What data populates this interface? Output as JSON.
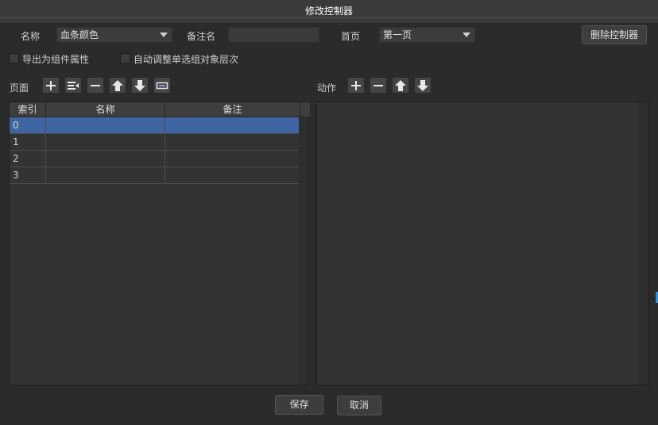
{
  "window": {
    "title": "修改控制器"
  },
  "form": {
    "name_label": "名称",
    "name_value": "血条颜色",
    "remark_label": "备注名",
    "remark_value": "",
    "home_label": "首页",
    "home_value": "第一页",
    "delete_button": "删除控制器",
    "export_checkbox": "导出为组件属性",
    "auto_adjust_checkbox": "自动调整单选组对象层次"
  },
  "pages": {
    "label": "页面",
    "columns": [
      "索引",
      "名称",
      "备注"
    ],
    "rows": [
      {
        "index": "0",
        "name": "",
        "remark": ""
      },
      {
        "index": "1",
        "name": "",
        "remark": ""
      },
      {
        "index": "2",
        "name": "",
        "remark": ""
      },
      {
        "index": "3",
        "name": "",
        "remark": ""
      }
    ],
    "selected_row": 0
  },
  "actions": {
    "label": "动作"
  },
  "footer": {
    "save_button": "保存",
    "cancel_button": "取消"
  },
  "colors": {
    "background": "#2b2b2b",
    "selection": "#3e64a1",
    "titlebar": "#3a3a3a"
  }
}
